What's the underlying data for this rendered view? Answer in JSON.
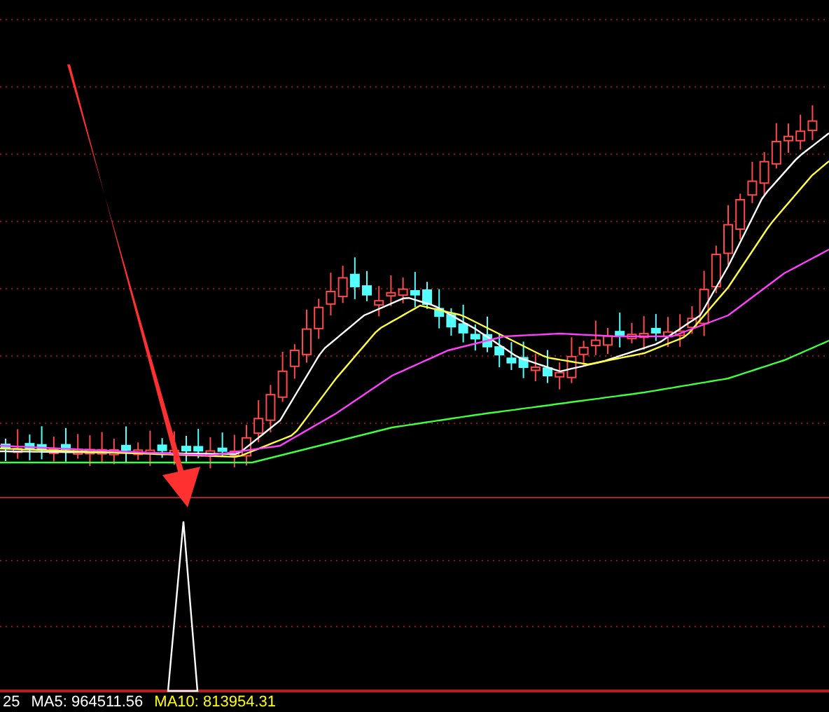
{
  "legend": [
    {
      "label": "25",
      "color": "#ffffff"
    },
    {
      "label": "MA5: 964511.56",
      "color": "#ffffff"
    },
    {
      "label": "MA10: 813954.31",
      "color": "#ffff00"
    }
  ]
}
